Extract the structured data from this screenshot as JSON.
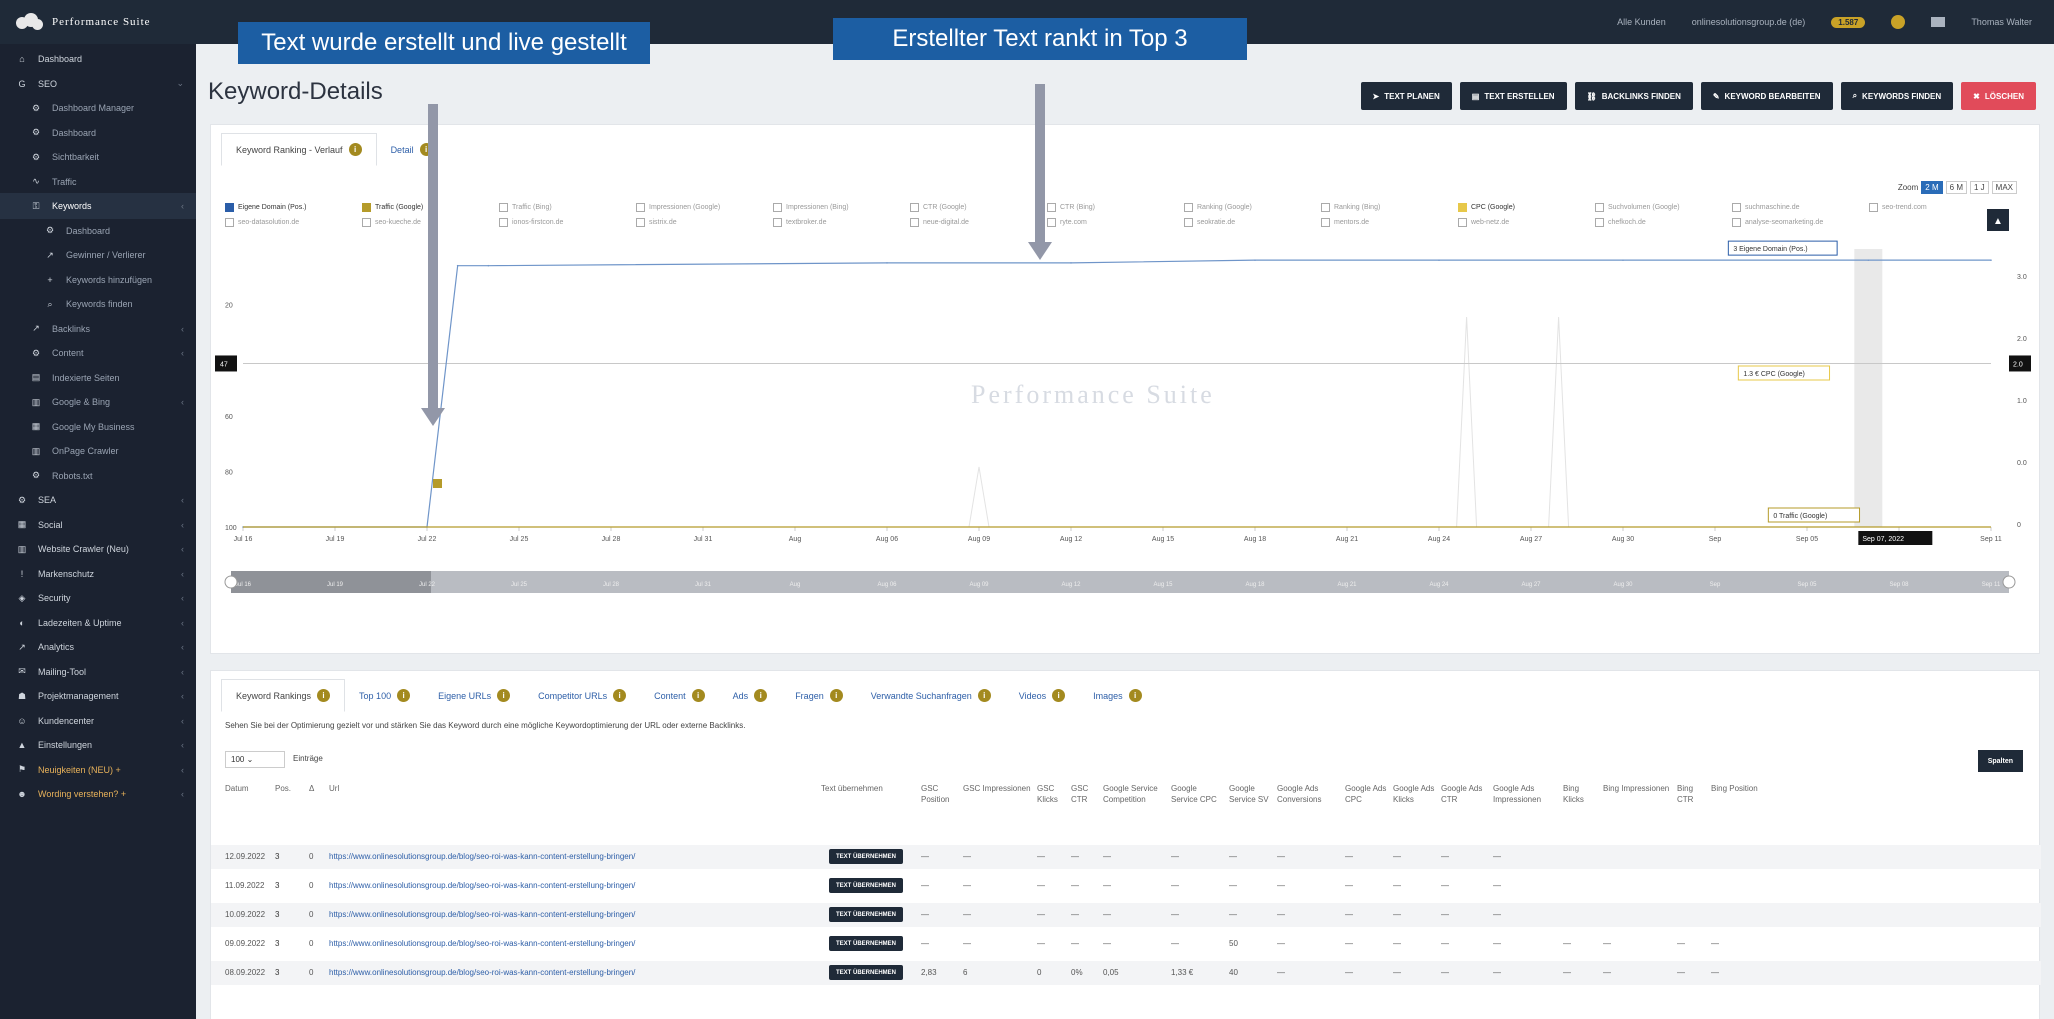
{
  "app": {
    "brand": "Performance Suite"
  },
  "topbar": {
    "items": [
      "Alle Kunden",
      "onlinesolutionsgroup.de (de)",
      "Credits 1.587",
      "Thomas Walter"
    ],
    "credits_badge": "1.587"
  },
  "sidebar": {
    "items": [
      {
        "label": "Dashboard",
        "icon": "home-icon",
        "level": 0
      },
      {
        "label": "SEO",
        "icon": "google-icon",
        "level": 0,
        "expanded": true
      },
      {
        "label": "Dashboard Manager",
        "icon": "gear-icon",
        "level": 1
      },
      {
        "label": "Dashboard",
        "icon": "gear-icon",
        "level": 1
      },
      {
        "label": "Sichtbarkeit",
        "icon": "gear-icon",
        "level": 1
      },
      {
        "label": "Traffic",
        "icon": "traffic-icon",
        "level": 1
      },
      {
        "label": "Keywords",
        "icon": "key-icon",
        "level": 1,
        "active": true
      },
      {
        "label": "Dashboard",
        "icon": "gear-icon",
        "level": 2
      },
      {
        "label": "Gewinner / Verlierer",
        "icon": "chart-icon",
        "level": 2
      },
      {
        "label": "Keywords hinzufügen",
        "icon": "plus-icon",
        "level": 2
      },
      {
        "label": "Keywords finden",
        "icon": "search-icon",
        "level": 2
      },
      {
        "label": "Backlinks",
        "icon": "chart-icon",
        "level": 1
      },
      {
        "label": "Content",
        "icon": "gear-icon",
        "level": 1
      },
      {
        "label": "Indexierte Seiten",
        "icon": "doc-icon",
        "level": 1
      },
      {
        "label": "Google & Bing",
        "icon": "bar-icon",
        "level": 1
      },
      {
        "label": "Google My Business",
        "icon": "store-icon",
        "level": 1
      },
      {
        "label": "OnPage Crawler",
        "icon": "bar-icon",
        "level": 1
      },
      {
        "label": "Robots.txt",
        "icon": "gear-icon",
        "level": 1
      },
      {
        "label": "SEA",
        "icon": "gear-icon",
        "level": 0
      },
      {
        "label": "Social",
        "icon": "grid-icon",
        "level": 0
      },
      {
        "label": "Website Crawler (Neu)",
        "icon": "bar-icon",
        "level": 0
      },
      {
        "label": "Markenschutz",
        "icon": "exclamation-icon",
        "level": 0
      },
      {
        "label": "Security",
        "icon": "shield-icon",
        "level": 0
      },
      {
        "label": "Ladezeiten & Uptime",
        "icon": "gauge-icon",
        "level": 0
      },
      {
        "label": "Analytics",
        "icon": "chart-icon",
        "level": 0
      },
      {
        "label": "Mailing-Tool",
        "icon": "mail-icon",
        "level": 0
      },
      {
        "label": "Projektmanagement",
        "icon": "users-icon",
        "level": 0
      },
      {
        "label": "Kundencenter",
        "icon": "user-icon",
        "level": 0
      },
      {
        "label": "Einstellungen",
        "icon": "lock-icon",
        "level": 0
      },
      {
        "label": "Neuigkeiten (NEU) +",
        "icon": "flag-icon",
        "level": 0,
        "highlight": true
      },
      {
        "label": "Wording verstehen? +",
        "icon": "people-icon",
        "level": 0,
        "highlight": true
      }
    ]
  },
  "page": {
    "title": "Keyword-Details"
  },
  "actions": [
    {
      "label": "Text planen",
      "icon": "send-icon"
    },
    {
      "label": "Text erstellen",
      "icon": "doc-icon"
    },
    {
      "label": "Backlinks finden",
      "icon": "link-icon"
    },
    {
      "label": "Keyword bearbeiten",
      "icon": "edit-icon"
    },
    {
      "label": "Keywords finden",
      "icon": "search-icon"
    },
    {
      "label": "Löschen",
      "icon": "trash-icon",
      "danger": true
    }
  ],
  "chart_tabs": [
    {
      "label": "Keyword Ranking - Verlauf",
      "active": true
    },
    {
      "label": "Detail",
      "active": false
    }
  ],
  "zoom": {
    "label": "Zoom",
    "options": [
      "2 M",
      "6 M",
      "1 J",
      "MAX"
    ],
    "selected": "2 M"
  },
  "legend": {
    "row1": [
      {
        "label": "Eigene Domain (Pos.)",
        "color": "#2a5da8",
        "on": true
      },
      {
        "label": "Traffic (Google)",
        "color": "#b59b2a",
        "on": true
      },
      {
        "label": "Traffic (Bing)",
        "on": false
      },
      {
        "label": "Impressionen (Google)",
        "on": false
      },
      {
        "label": "Impressionen (Bing)",
        "on": false
      },
      {
        "label": "CTR (Google)",
        "on": false
      },
      {
        "label": "CTR (Bing)",
        "on": false
      },
      {
        "label": "Ranking (Google)",
        "on": false
      },
      {
        "label": "Ranking (Bing)",
        "on": false
      },
      {
        "label": "CPC (Google)",
        "color": "#e7c84a",
        "on": true
      },
      {
        "label": "Suchvolumen (Google)",
        "on": false
      },
      {
        "label": "suchmaschine.de",
        "on": false
      },
      {
        "label": "seo-trend.com",
        "on": false
      }
    ],
    "row2": [
      {
        "label": "seo-datasolution.de",
        "on": false
      },
      {
        "label": "seo-kueche.de",
        "on": false
      },
      {
        "label": "ionos-firstcon.de",
        "on": false
      },
      {
        "label": "sistrix.de",
        "on": false
      },
      {
        "label": "textbroker.de",
        "on": false
      },
      {
        "label": "neue-digital.de",
        "on": false
      },
      {
        "label": "ryte.com",
        "on": false
      },
      {
        "label": "seokratie.de",
        "on": false
      },
      {
        "label": "mentors.de",
        "on": false
      },
      {
        "label": "web-netz.de",
        "on": false
      },
      {
        "label": "chefkoch.de",
        "on": false
      },
      {
        "label": "analyse-seomarketing.de",
        "on": false
      }
    ]
  },
  "chart_data": {
    "type": "line",
    "x_ticks": [
      "Jul 16",
      "Jul 19",
      "Jul 22",
      "Jul 25",
      "Jul 28",
      "Jul 31",
      "Aug",
      "Aug 06",
      "Aug 09",
      "Aug 12",
      "Aug 15",
      "Aug 18",
      "Aug 21",
      "Aug 24",
      "Aug 27",
      "Aug 30",
      "Sep",
      "Sep 05",
      "Sep 08",
      "Sep 11"
    ],
    "y_left_ticks": [
      "20",
      "40",
      "60",
      "80",
      "100"
    ],
    "y_left_range": [
      0,
      100
    ],
    "y_left_reversed": true,
    "y_right_ticks": [
      "3.0",
      "2.0",
      "1.0",
      "0.0",
      "0"
    ],
    "crosshair_left": "47",
    "crosshair_right": "2.0",
    "crosshair_date": "Sep 07, 2022",
    "series": [
      {
        "name": "Eigene Domain (Pos.)",
        "axis": "left",
        "color": "#6f95c9",
        "dates": [
          "Jul 16",
          "Jul 22",
          "Jul 23",
          "Jul 24",
          "Aug 06",
          "Aug 12",
          "Aug 18",
          "Aug 24",
          "Aug 30",
          "Sep 07",
          "Sep 11"
        ],
        "values": [
          100,
          100,
          6,
          6,
          5,
          5,
          4,
          4,
          4,
          4,
          4
        ]
      },
      {
        "name": "CPC (Google)",
        "axis": "right",
        "color": "#e7c84a",
        "dates": [
          "Jul 16",
          "Sep 11"
        ],
        "values": [
          1.3,
          1.3
        ]
      },
      {
        "name": "Traffic (Google)",
        "axis": "right",
        "color": "#b59b2a",
        "dates": [
          "Jul 16",
          "Sep 11"
        ],
        "values": [
          0,
          0
        ]
      }
    ],
    "tooltips": [
      "3 Eigene Domain (Pos.)",
      "1.3 € CPC (Google)",
      "0 Traffic (Google)"
    ],
    "watermark": "Performance Suite"
  },
  "annotations": [
    {
      "text": "Text wurde erstellt und live gestellt"
    },
    {
      "text": "Erstellter Text rankt in Top 3"
    }
  ],
  "bottom_tabs": [
    {
      "label": "Keyword Rankings",
      "active": true
    },
    {
      "label": "Top 100"
    },
    {
      "label": "Eigene URLs"
    },
    {
      "label": "Competitor URLs"
    },
    {
      "label": "Content"
    },
    {
      "label": "Ads"
    },
    {
      "label": "Fragen"
    },
    {
      "label": "Verwandte Suchanfragen"
    },
    {
      "label": "Videos"
    },
    {
      "label": "Images"
    }
  ],
  "table": {
    "description": "Sehen Sie bei der Optimierung gezielt vor und stärken Sie das Keyword durch eine mögliche Keywordoptimierung der URL oder externe Backlinks.",
    "page_size": "100",
    "page_size_label": "Einträge",
    "split_button": "Spalten",
    "columns": [
      "Datum",
      "Pos.",
      "Δ",
      "Url",
      "Text übernehmen",
      "GSC Position",
      "GSC Impressionen",
      "GSC Klicks",
      "GSC CTR",
      "Google Service Competition",
      "Google Service CPC",
      "Google Service SV",
      "Google Ads Conversions",
      "Google Ads CPC",
      "Google Ads Klicks",
      "Google Ads CTR",
      "Google Ads Impressionen",
      "Bing Klicks",
      "Bing Impressionen",
      "Bing CTR",
      "Bing Position"
    ],
    "rows": [
      {
        "date": "12.09.2022",
        "pos": "3",
        "delta": "0",
        "url": "https://www.onlinesolutionsgroup.de/blog/seo-roi-was-kann-content-erstellung-bringen/",
        "btn": "Text übernehmen",
        "cells": [
          "—",
          "—",
          "—",
          "—",
          "—",
          "—",
          "—",
          "—",
          "—",
          "—",
          "—",
          "—",
          "",
          "",
          "",
          ""
        ]
      },
      {
        "date": "11.09.2022",
        "pos": "3",
        "delta": "0",
        "url": "https://www.onlinesolutionsgroup.de/blog/seo-roi-was-kann-content-erstellung-bringen/",
        "btn": "Text übernehmen",
        "cells": [
          "—",
          "—",
          "—",
          "—",
          "—",
          "—",
          "—",
          "—",
          "—",
          "—",
          "—",
          "—",
          "",
          "",
          "",
          ""
        ]
      },
      {
        "date": "10.09.2022",
        "pos": "3",
        "delta": "0",
        "url": "https://www.onlinesolutionsgroup.de/blog/seo-roi-was-kann-content-erstellung-bringen/",
        "btn": "Text übernehmen",
        "cells": [
          "—",
          "—",
          "—",
          "—",
          "—",
          "—",
          "—",
          "—",
          "—",
          "—",
          "—",
          "—",
          "",
          "",
          "",
          ""
        ]
      },
      {
        "date": "09.09.2022",
        "pos": "3",
        "delta": "0",
        "url": "https://www.onlinesolutionsgroup.de/blog/seo-roi-was-kann-content-erstellung-bringen/",
        "btn": "Text übernehmen",
        "cells": [
          "—",
          "—",
          "—",
          "—",
          "—",
          "—",
          "50",
          "—",
          "—",
          "—",
          "—",
          "—",
          "—",
          "—",
          "—",
          "—"
        ]
      },
      {
        "date": "08.09.2022",
        "pos": "3",
        "delta": "0",
        "url": "https://www.onlinesolutionsgroup.de/blog/seo-roi-was-kann-content-erstellung-bringen/",
        "btn": "Text übernehmen",
        "cells": [
          "2,83",
          "6",
          "0",
          "0%",
          "0,05",
          "1,33 €",
          "40",
          "—",
          "—",
          "—",
          "—",
          "—",
          "—",
          "—",
          "—",
          "—"
        ]
      }
    ]
  }
}
